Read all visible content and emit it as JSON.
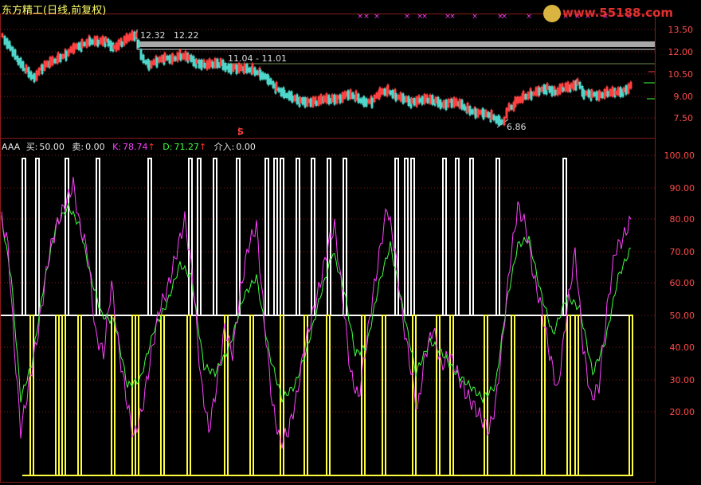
{
  "header": {
    "stock_name": "东方精工",
    "period_label": "(日线,前复权)"
  },
  "watermark": {
    "text": "www.55188.com"
  },
  "price_panel": {
    "y_ticks": [
      "13.50",
      "12.00",
      "10.50",
      "9.00",
      "7.50"
    ],
    "annotations": {
      "high_label": "12.32",
      "high_label2": "12.22",
      "mid_label": "11.04 - 11.01",
      "low_label": "6.86",
      "signal_marker": "S"
    }
  },
  "indicator_panel": {
    "name": "AAA",
    "buy_label": "买:",
    "buy_value": "50.00",
    "sell_label": "卖:",
    "sell_value": "0.00",
    "k_label": "K:",
    "k_value": "78.74",
    "d_label": "D:",
    "d_value": "71.27",
    "entry_label": "介入:",
    "entry_value": "0.00",
    "up_arrow": "↑",
    "y_ticks": [
      "100.00",
      "90.00",
      "80.00",
      "70.00",
      "60.00",
      "50.00",
      "40.00",
      "30.00",
      "20.00"
    ]
  },
  "colors": {
    "grid_red": "#8b1a1a",
    "candle_up": "#ff4040",
    "candle_down": "#4dd6c9",
    "k_line": "#ff40ff",
    "d_line": "#40ff40",
    "buy_signal": "#ffffff",
    "sell_signal": "#ffff40",
    "axis_text": "#ff4a4a",
    "ma_gray": "#9a9a9a"
  },
  "chart_data": {
    "type": "line",
    "k_last": 78.74,
    "d_last": 71.27,
    "price_ylim": [
      7.0,
      13.8
    ],
    "indicator_ylim": [
      0,
      100
    ],
    "price_low": 6.86,
    "price_high": 12.32
  }
}
